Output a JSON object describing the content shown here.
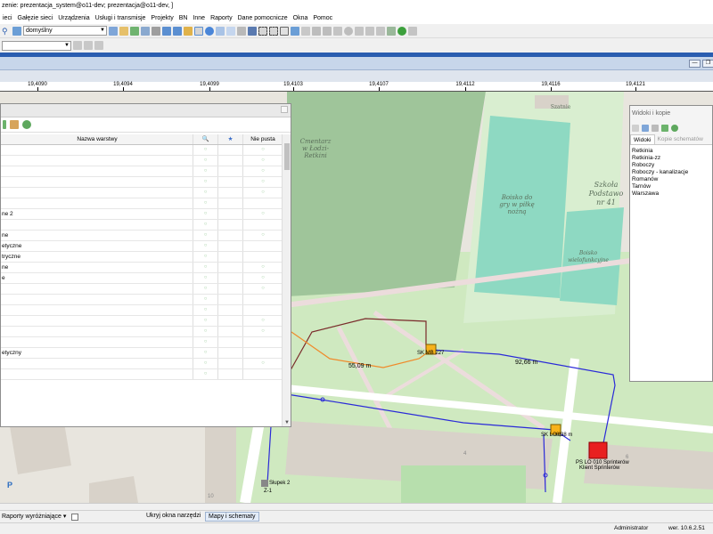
{
  "window": {
    "title": "zenie: prezentacja_system@o11-dev; prezentacja@o11-dev, ]"
  },
  "menu": [
    "ieci",
    "Gałęzie sieci",
    "Urządzenia",
    "Usługi i transmisje",
    "Projekty",
    "BN",
    "Inne",
    "Raporty",
    "Dane pomocnicze",
    "Okna",
    "Pomoc"
  ],
  "toolbar": {
    "style_combo_value": "domyślny"
  },
  "ruler": {
    "ticks": [
      "19,4090",
      "19,4094",
      "19,4099",
      "19,4103",
      "19,4107",
      "19,4112",
      "19,4116",
      "19,4121"
    ]
  },
  "map": {
    "labels": {
      "cemetery": "Cmentarz w Łodzi- Retkini",
      "pitch": "Boisko do gry w piłkę nożną",
      "school": "Szkoła Podstawo nr 41",
      "multi_pitch": "Boisko wielofunkcyjne",
      "shelter": "Szatnie"
    },
    "network": {
      "sk1": "SK MB 227",
      "sk2": "SK LO 1",
      "sk2_len": "8,38 m",
      "ps": "PS LO 010 Sprinterów",
      "ps2": "Klient Sprinterów",
      "len1": "55,09 m",
      "len2": "92,66 m",
      "slupek": "Słupek 2",
      "z1": "Z-1",
      "b1": "4",
      "b2": "6",
      "b3": "10"
    }
  },
  "layers_panel": {
    "columns": {
      "name": "Nazwa warstwy",
      "search": "🔍",
      "star": "★",
      "nonempty": "Nie pusta"
    },
    "rows": [
      {
        "name": "",
        "v1": "○",
        "v3": "○"
      },
      {
        "name": "",
        "v1": "○",
        "v3": "○"
      },
      {
        "name": "",
        "v1": "○",
        "v3": "○"
      },
      {
        "name": "",
        "v1": "○",
        "v3": "○"
      },
      {
        "name": "",
        "v1": "○",
        "v3": "○"
      },
      {
        "name": "",
        "v1": "○",
        "v3": ""
      },
      {
        "name": "ne 2",
        "v1": "○",
        "v3": "○"
      },
      {
        "name": "",
        "v1": "○",
        "v3": ""
      },
      {
        "name": "ne",
        "v1": "○",
        "v3": "○"
      },
      {
        "name": "etyczne",
        "v1": "○",
        "v3": ""
      },
      {
        "name": "tryczne",
        "v1": "○",
        "v3": ""
      },
      {
        "name": "ne",
        "v1": "○",
        "v3": "○"
      },
      {
        "name": "e",
        "v1": "○",
        "v3": "○"
      },
      {
        "name": "",
        "v1": "○",
        "v3": "○"
      },
      {
        "name": "",
        "v1": "○",
        "v3": ""
      },
      {
        "name": "",
        "v1": "○",
        "v3": ""
      },
      {
        "name": "",
        "v1": "○",
        "v3": "○"
      },
      {
        "name": "",
        "v1": "○",
        "v3": "○"
      },
      {
        "name": "",
        "v1": "○",
        "v3": ""
      },
      {
        "name": "etyczny",
        "v1": "○",
        "v3": ""
      },
      {
        "name": "",
        "v1": "○",
        "v3": "○"
      },
      {
        "name": "",
        "v1": "○",
        "v3": ""
      }
    ]
  },
  "views_panel": {
    "title": "Widoki i kopie",
    "tab_views": "Widoki",
    "tab_copies": "Kopie schematów",
    "items": [
      "Retkinia",
      "Retkinia-zz",
      "Roboczy",
      "Roboczy - kanalizacje",
      "Romanów",
      "Tarnów",
      "Warszawa"
    ]
  },
  "bottom": {
    "reports": "Raporty wyróżniające",
    "hide_tools": "Ukryj okna narzędzi",
    "maps_tab": "Mapy i schematy"
  },
  "status": {
    "user": "Administrator",
    "version": "wer. 10.6.2.51"
  },
  "colors": {
    "accent": "#2a5db0",
    "park": "#cfe9c0",
    "cemetery": "#9fc59a",
    "pitch": "#8ed9c2",
    "building": "#d8d2c9",
    "node": "#f7b21b",
    "station": "#e82020"
  }
}
